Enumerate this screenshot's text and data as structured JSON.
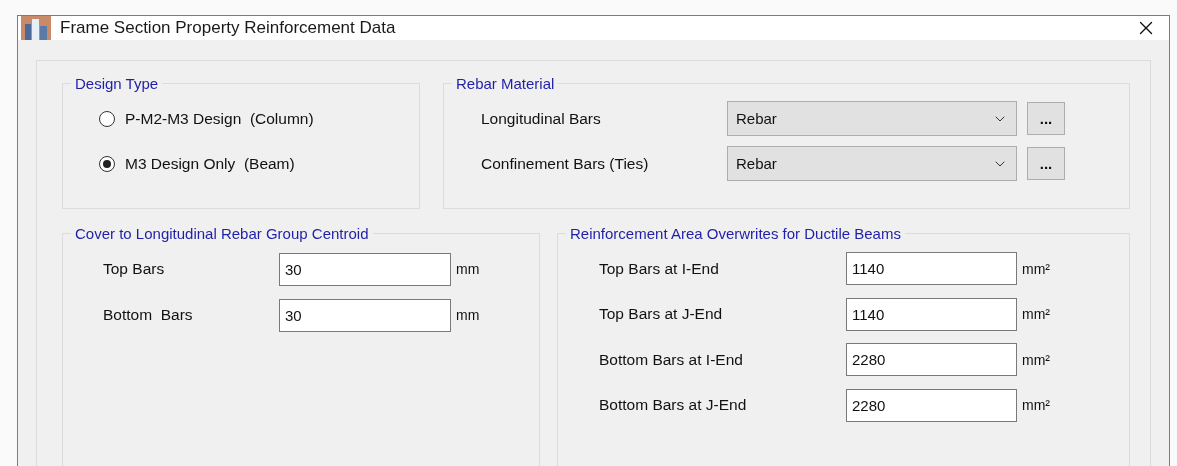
{
  "window": {
    "title": "Frame Section Property Reinforcement Data"
  },
  "design_type": {
    "title": "Design Type",
    "options": [
      {
        "label": "P-M2-M3 Design  (Column)",
        "selected": false
      },
      {
        "label": "M3 Design Only  (Beam)",
        "selected": true
      }
    ]
  },
  "rebar_material": {
    "title": "Rebar Material",
    "rows": [
      {
        "label": "Longitudinal Bars",
        "value": "Rebar",
        "button": "..."
      },
      {
        "label": "Confinement Bars (Ties)",
        "value": "Rebar",
        "button": "..."
      }
    ]
  },
  "cover": {
    "title": "Cover to Longitudinal Rebar Group Centroid",
    "rows": [
      {
        "label": "Top Bars",
        "value": "30",
        "unit": "mm"
      },
      {
        "label": "Bottom  Bars",
        "value": "30",
        "unit": "mm"
      }
    ]
  },
  "overwrites": {
    "title": "Reinforcement Area Overwrites for Ductile Beams",
    "rows": [
      {
        "label": "Top Bars at I-End",
        "value": "1140",
        "unit": "mm²"
      },
      {
        "label": "Top Bars at J-End",
        "value": "1140",
        "unit": "mm²"
      },
      {
        "label": "Bottom Bars at I-End",
        "value": "2280",
        "unit": "mm²"
      },
      {
        "label": "Bottom Bars at J-End",
        "value": "2280",
        "unit": "mm²"
      }
    ]
  }
}
